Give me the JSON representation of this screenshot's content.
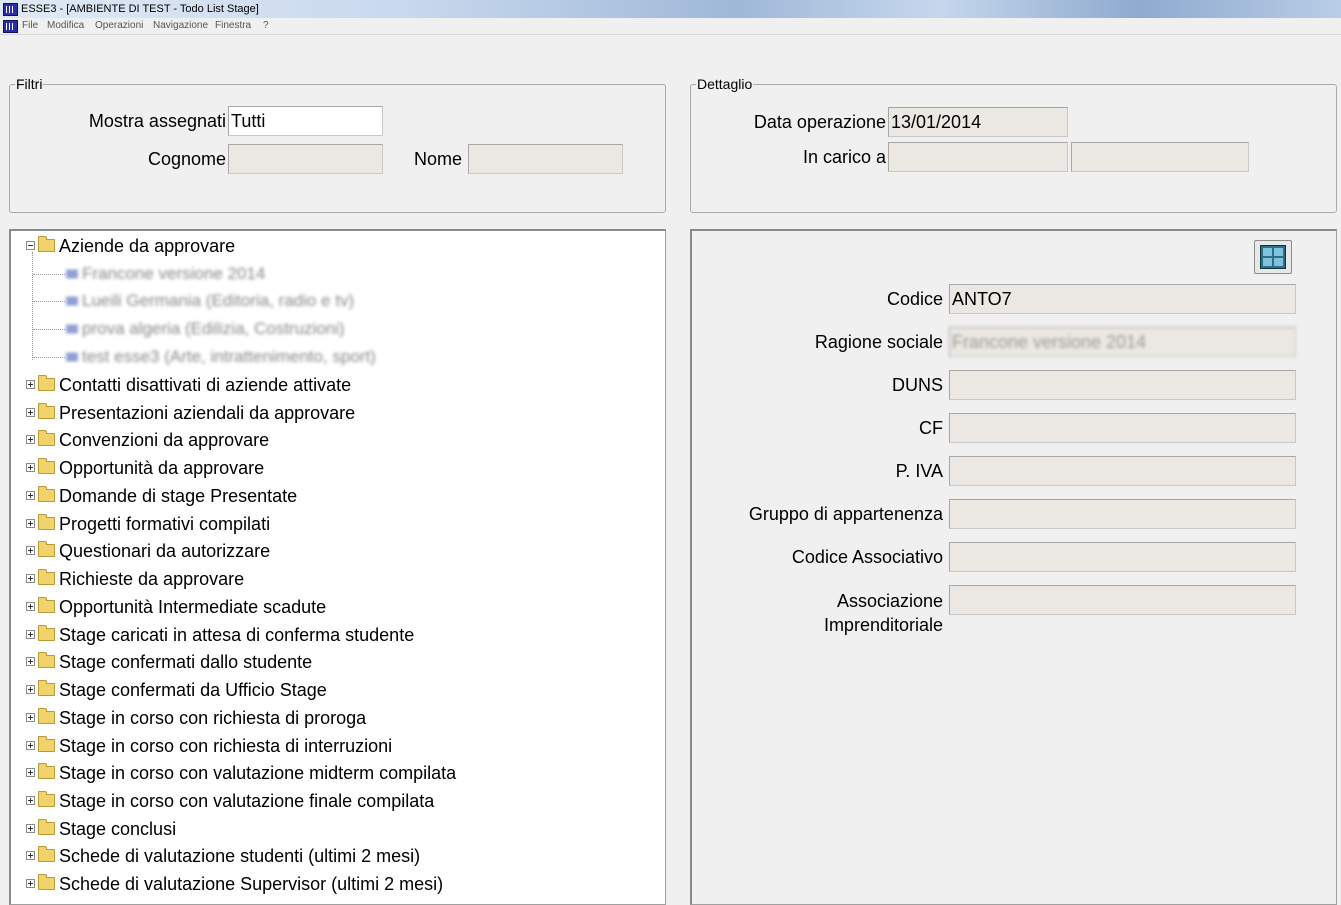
{
  "window": {
    "title": "ESSE3 - [AMBIENTE DI TEST - Todo List Stage]"
  },
  "menu": [
    "File",
    "Modifica",
    "Operazioni",
    "Navigazione",
    "Finestra",
    "?"
  ],
  "filters": {
    "legend": "Filtri",
    "mostra_assegnati_label": "Mostra assegnati",
    "mostra_assegnati_value": "Tutti",
    "cognome_label": "Cognome",
    "cognome_value": "",
    "nome_label": "Nome",
    "nome_value": ""
  },
  "detail_header": {
    "legend": "Dettaglio",
    "data_operazione_label": "Data operazione",
    "data_operazione_value": "13/01/2014",
    "in_carico_label": "In carico a",
    "in_carico_value1": "",
    "in_carico_value2": ""
  },
  "tree": {
    "expanded": {
      "label": "Aziende da approvare",
      "children": [
        "Francone versione 2014",
        "Lueili Germania (Editoria, radio e tv)",
        "prova algeria (Edilizia, Costruzioni)",
        "test esse3 (Arte, intrattenimento, sport)"
      ]
    },
    "collapsed": [
      "Contatti disattivati di aziende attivate",
      "Presentazioni aziendali da approvare",
      "Convenzioni da approvare",
      "Opportunità da approvare",
      "Domande di stage Presentate",
      "Progetti formativi compilati",
      "Questionari da autorizzare",
      "Richieste da approvare",
      "Opportunità Intermediate scadute",
      "Stage caricati in attesa di conferma studente",
      "Stage confermati dallo studente",
      "Stage confermati da Ufficio Stage",
      "Stage in corso con richiesta di proroga",
      "Stage in corso con richiesta di interruzioni",
      "Stage in corso con valutazione midterm compilata",
      "Stage in corso con valutazione finale compilata",
      "Stage conclusi",
      "Schede di valutazione studenti (ultimi 2 mesi)",
      "Schede di valutazione Supervisor (ultimi 2 mesi)"
    ]
  },
  "detail": {
    "codice_label": "Codice",
    "codice_value": "ANTO7",
    "ragione_label": "Ragione sociale",
    "ragione_value": "Francone versione 2014",
    "duns_label": "DUNS",
    "duns_value": "",
    "cf_label": "CF",
    "cf_value": "",
    "piva_label": "P. IVA",
    "piva_value": "",
    "gruppo_label": "Gruppo di appartenenza",
    "gruppo_value": "",
    "codass_label": "Codice Associativo",
    "codass_value": "",
    "assoc_label_1": "Associazione",
    "assoc_label_2": "Imprenditoriale",
    "assoc_value": ""
  },
  "icons": {
    "app": "app-icon",
    "view_toggle": "window-view-icon"
  }
}
